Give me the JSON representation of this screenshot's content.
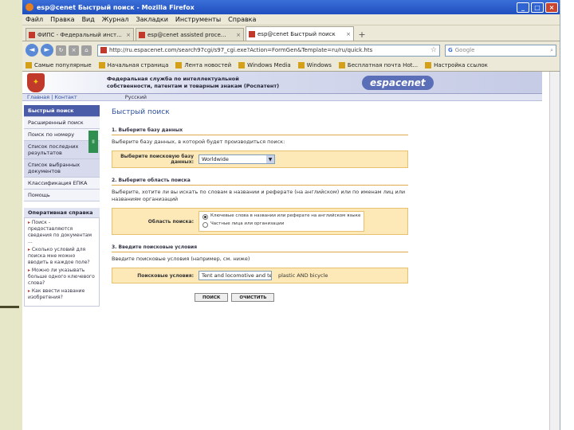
{
  "window": {
    "title": "esp@cenet Быстрый поиск - Mozilla Firefox",
    "controls": [
      "_",
      "□",
      "×"
    ]
  },
  "menu": [
    "Файл",
    "Правка",
    "Вид",
    "Журнал",
    "Закладки",
    "Инструменты",
    "Справка"
  ],
  "tabs": [
    {
      "label": "ФИПС - Федеральный инст...",
      "active": false
    },
    {
      "label": "esp@cenet assisted proce...",
      "active": false
    },
    {
      "label": "esp@cenet Быстрый поиск",
      "active": true
    }
  ],
  "nav": {
    "back": "◄",
    "forward": "►",
    "url": "http://ru.espacenet.com/search97cgi/s97_cgi.exe?Action=FormGen&Template=ru/ru/quick.hts",
    "star": "☆",
    "search_placeholder": "Google"
  },
  "bookmarks": [
    "Самые популярные",
    "Начальная страница",
    "Лента новостей",
    "Windows Media",
    "Windows",
    "Бесплатная почта Hot...",
    "Настройка ссылок"
  ],
  "page": {
    "header_text": "Федеральная служба по интеллектуальной собственности, патентам и товарным знакам (Роспатент)",
    "logo": "espacenet",
    "nav_left": "Главная | Контакт",
    "language": "Русский",
    "sidebar": [
      {
        "label": "Быстрый поиск",
        "active": true
      },
      {
        "label": "Расширенный поиск",
        "active": false
      },
      {
        "label": "Поиск по номеру",
        "active": false
      },
      {
        "label": "Список последних результатов",
        "active": false,
        "hl": true
      },
      {
        "label": "Список выбранных документов",
        "active": false,
        "hl": true
      },
      {
        "label": "Классификация ЕПКА",
        "active": false
      },
      {
        "label": "Помощь",
        "active": false
      }
    ],
    "help_title": "Оперативная справка",
    "help_items": [
      "Поиск - предоставляются сведения по документам ...",
      "Сколько условий для поиска мне можно вводить в каждое поле?",
      "Можно ли указывать больше одного ключевого слова?",
      "Как ввести название изобретения?"
    ],
    "green_tab": "II",
    "title": "Быстрый поиск",
    "step1": "1. Выберите базу данных",
    "step1_desc": "Выберите базу данных, в которой будет производиться поиск:",
    "db_label": "Выберите поисковую базу данных:",
    "db_value": "Worldwide",
    "step2": "2. Выберите область поиска",
    "step2_desc": "Выберите, хотите ли вы искать по словам в названии и реферате (на английском) или по именам лиц или названиям организаций",
    "area_label": "Область поиска:",
    "radio1": "Ключевые слова в названии или реферате на английском языке",
    "radio2": "Частные лица или организации",
    "step3": "3. Введите поисковые условия",
    "step3_desc": "Введите поисковые условия (например, см. ниже)",
    "terms_label": "Поисковые условия:",
    "terms_value": "Tent and locomotive and tent",
    "terms_hint": "plastic AND bicycle",
    "btn_search": "ПОИСК",
    "btn_clear": "ОЧИСТИТЬ"
  }
}
